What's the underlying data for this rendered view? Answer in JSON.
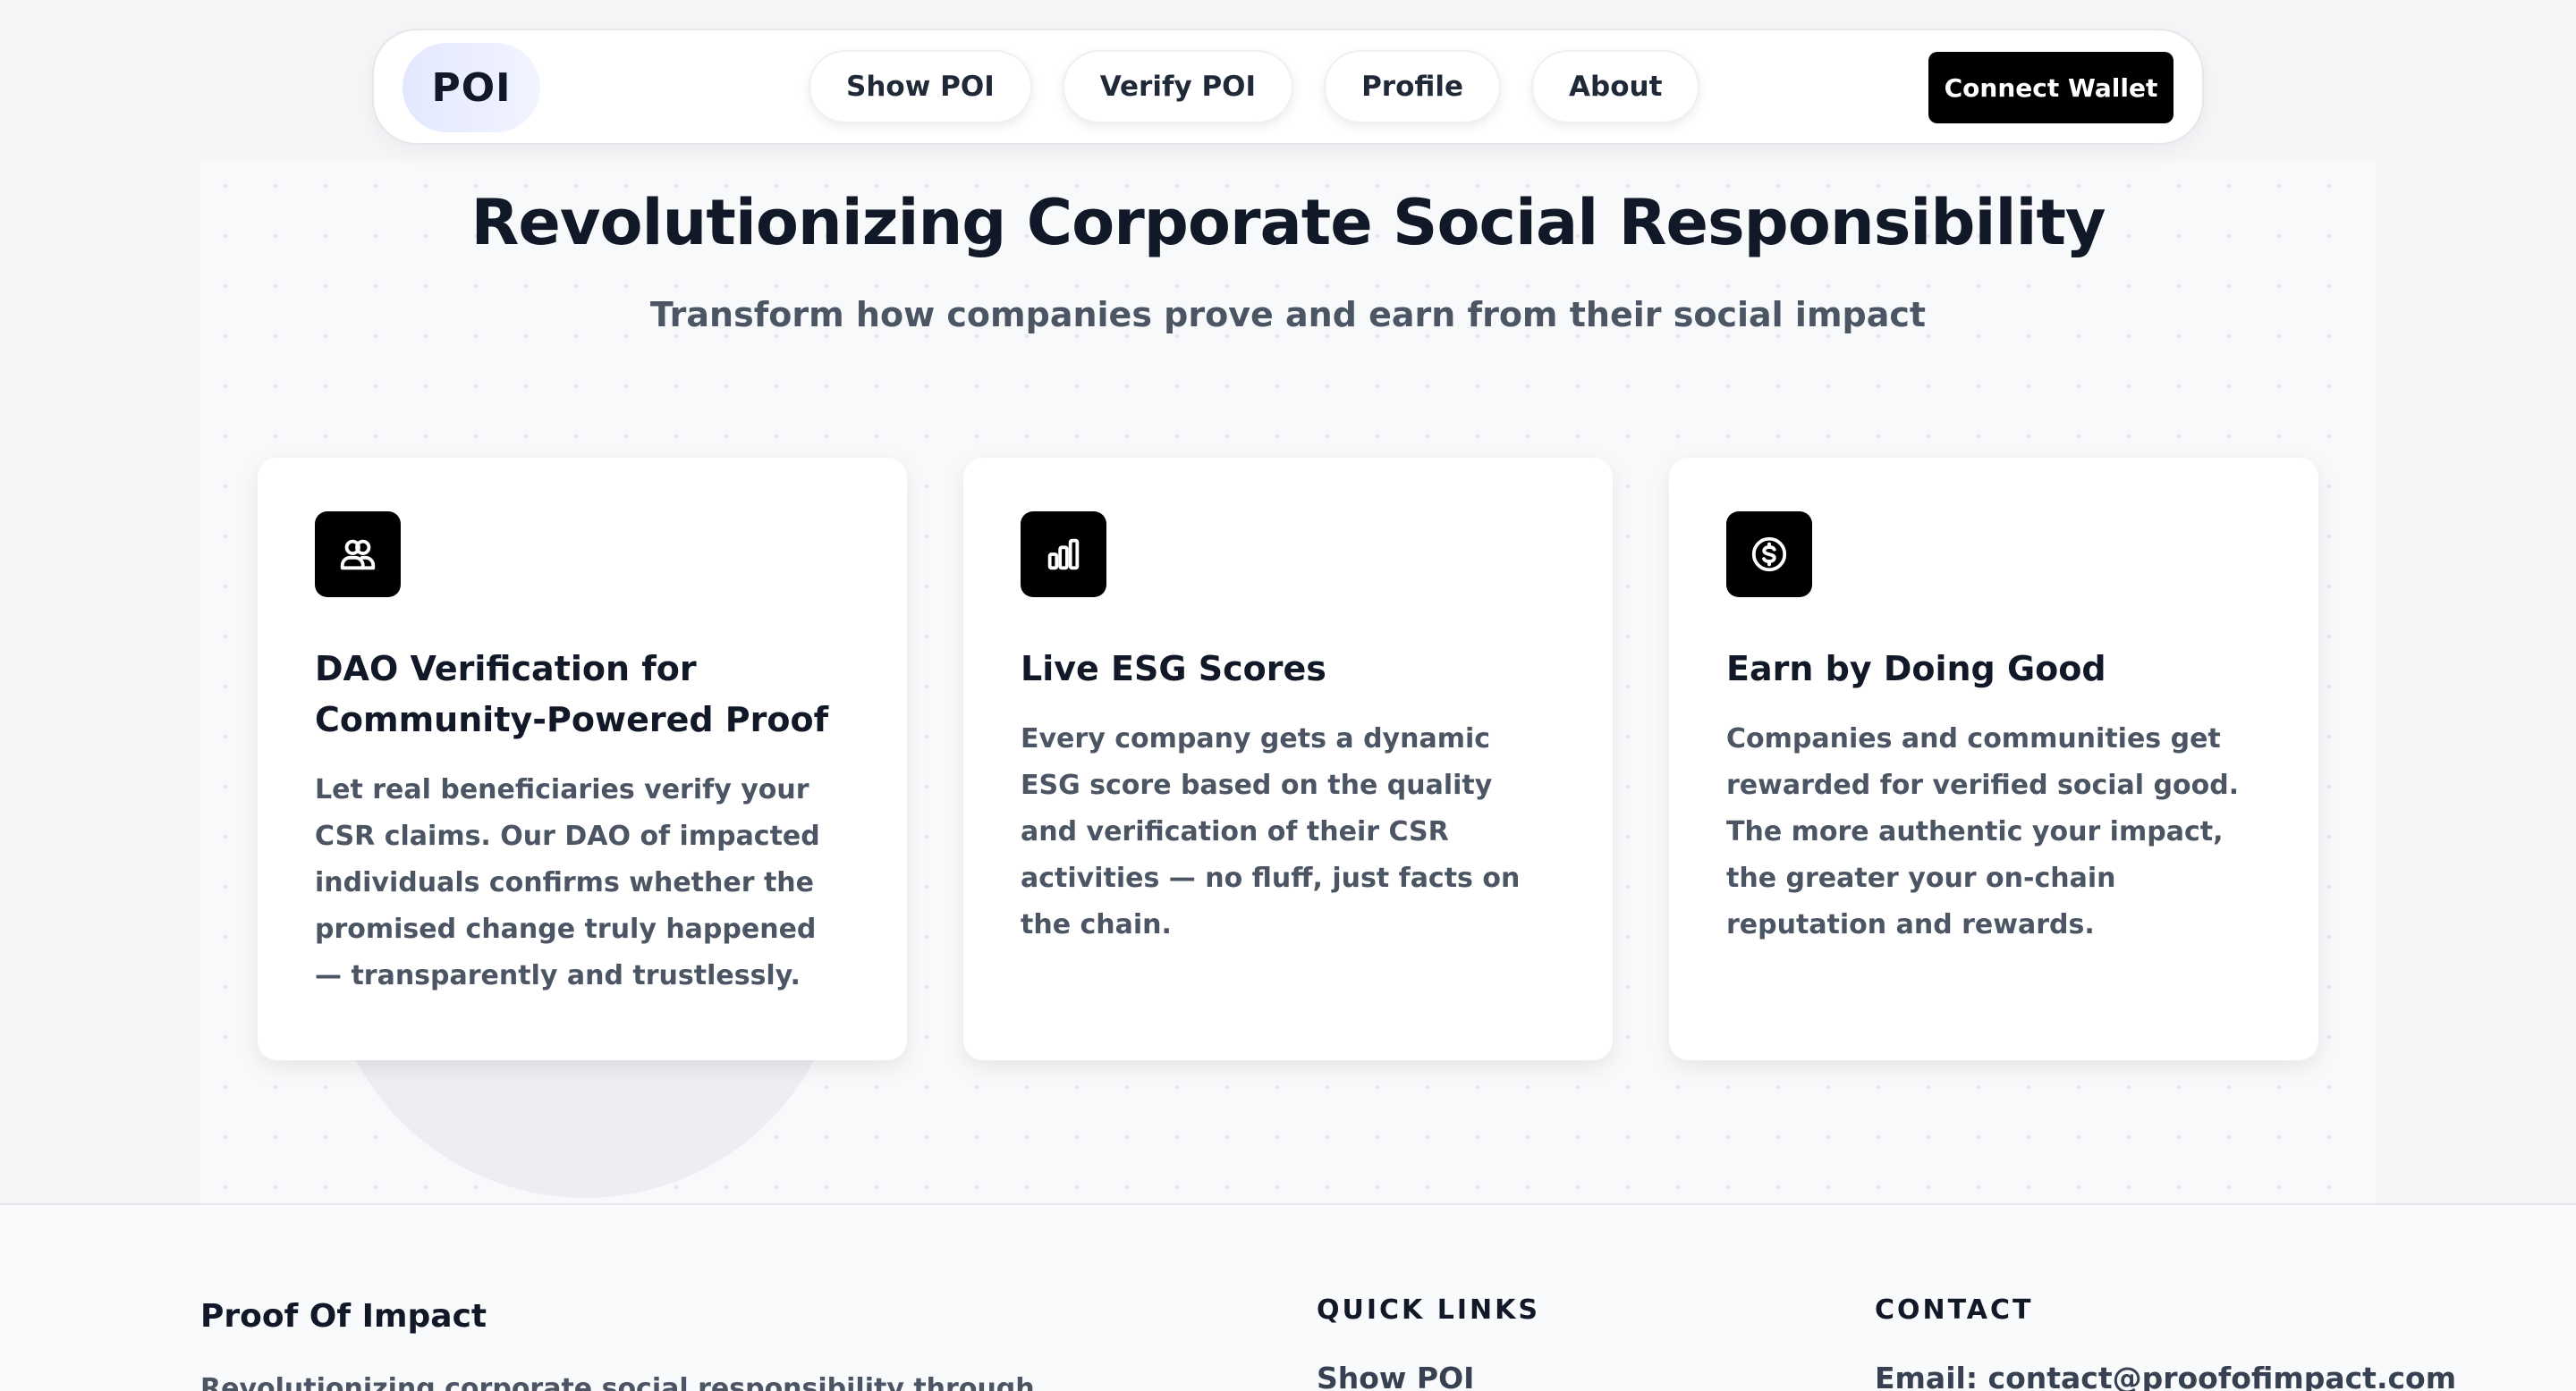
{
  "nav": {
    "logo": "POI",
    "links": [
      "Show POI",
      "Verify POI",
      "Profile",
      "About"
    ],
    "connect_wallet": "Connect Wallet"
  },
  "hero": {
    "title": "Revolutionizing Corporate Social Responsibility",
    "subtitle": "Transform how companies prove and earn from their social impact"
  },
  "features": [
    {
      "icon": "users-icon",
      "title": "DAO Verification for Community-Powered Proof",
      "body": "Let real beneficiaries verify your CSR claims. Our DAO of impacted individuals confirms whether the promised change truly happened — transparently and trustlessly."
    },
    {
      "icon": "bar-chart-icon",
      "title": "Live ESG Scores",
      "body": "Every company gets a dynamic ESG score based on the quality and verification of their CSR activities — no fluff, just facts on the chain."
    },
    {
      "icon": "dollar-coin-icon",
      "title": "Earn by Doing Good",
      "body": "Companies and communities get rewarded for verified social good. The more authentic your impact, the greater your on-chain reputation and rewards."
    }
  ],
  "footer": {
    "brand": "Proof Of Impact",
    "description": "Revolutionizing corporate social responsibility through",
    "quick_links_heading": "QUICK LINKS",
    "quick_links": [
      "Show POI"
    ],
    "contact_heading": "CONTACT",
    "contact_email": "Email: contact@proofofimpact.com"
  },
  "colors": {
    "primary": "#000000",
    "text_dark": "#111827",
    "text_muted": "#4b5563",
    "logo_gradient": "#e4e8ff"
  }
}
